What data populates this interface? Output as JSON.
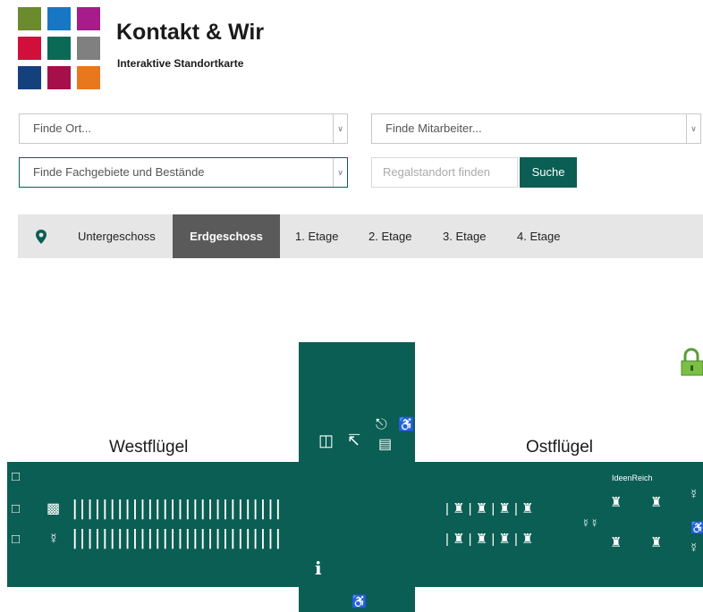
{
  "header": {
    "title": "Kontakt & Wir",
    "subtitle": "Interaktive Standortkarte",
    "logo_colors": [
      "#6c8a2e",
      "#1777c4",
      "#a51c8a",
      "#d0103b",
      "#0b6a55",
      "#808080",
      "#15407e",
      "#a5104a",
      "#e8781e"
    ]
  },
  "search": {
    "ort_placeholder": "Finde Ort...",
    "mitarbeiter_placeholder": "Finde Mitarbeiter...",
    "fachgebiete_placeholder": "Finde Fachgebiete und Bestände",
    "regal_placeholder": "Regalstandort finden",
    "search_label": "Suche"
  },
  "floors": {
    "items": [
      "Untergeschoss",
      "Erdgeschoss",
      "1. Etage",
      "2. Etage",
      "3. Etage",
      "4. Etage"
    ],
    "active": "Erdgeschoss"
  },
  "map": {
    "west_label": "Westflügel",
    "east_label": "Ostflügel",
    "ideen_label": "IdeenReich",
    "info_label": "i",
    "shelf_rows": "||||||||||||||||||||||||||||",
    "icons": [
      "elevator-icon",
      "stairs-icon",
      "exit-icon",
      "wheelchair-icon",
      "water-dispenser-icon",
      "printer-icon",
      "person-icon",
      "group-workspace-icon",
      "people-icon",
      "seat-terminal-icon",
      "info-icon",
      "lock-icon",
      "location-pin-icon"
    ],
    "accent_color": "#0b5e54"
  }
}
